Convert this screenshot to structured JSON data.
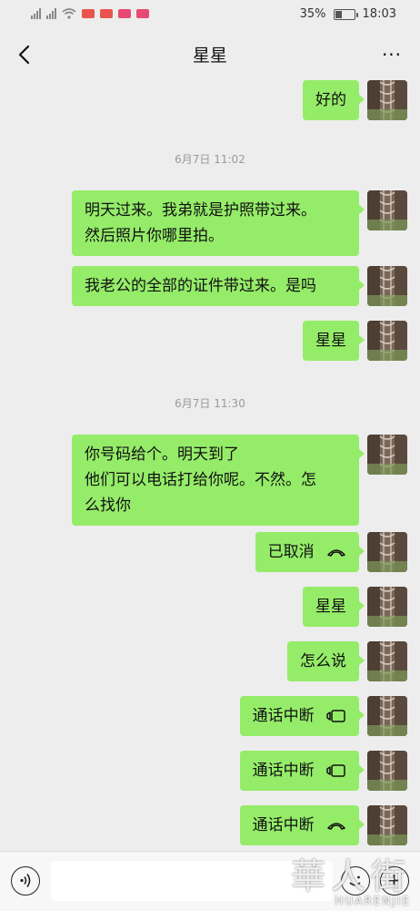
{
  "status_bar": {
    "battery_percent": "35%",
    "battery_level": 0.35,
    "time": "18:03"
  },
  "header": {
    "title": "星星",
    "back_icon": "chevron-left-icon",
    "more_icon": "more-dots-icon",
    "more_label": "···"
  },
  "messages": [
    {
      "type": "text",
      "text": "好的"
    },
    {
      "type": "timestamp",
      "text": "6月7日 11:02"
    },
    {
      "type": "text",
      "lines": [
        "明天过来。我弟就是护照带过来。",
        "然后照片你哪里拍。"
      ]
    },
    {
      "type": "text",
      "text": "我老公的全部的证件带过来。是吗"
    },
    {
      "type": "text",
      "text": "星星"
    },
    {
      "type": "timestamp",
      "text": "6月7日 11:30"
    },
    {
      "type": "text",
      "lines": [
        "你号码给个。明天到了",
        "他们可以电话打给你呢。不然。怎",
        "么找你"
      ]
    },
    {
      "type": "call",
      "text": "已取消",
      "icon": "phone-hangup-icon"
    },
    {
      "type": "text",
      "text": "星星"
    },
    {
      "type": "text",
      "text": "怎么说"
    },
    {
      "type": "call",
      "text": "通话中断",
      "icon": "video-call-icon"
    },
    {
      "type": "call",
      "text": "通话中断",
      "icon": "video-call-icon"
    },
    {
      "type": "call",
      "text": "通话中断",
      "icon": "phone-hangup-icon"
    }
  ],
  "input_bar": {
    "voice_icon": "voice-icon",
    "emoji_icon": "emoji-icon",
    "plus_icon": "plus-icon"
  },
  "watermark": {
    "cn": "華人街",
    "en": "HUARENJIE"
  },
  "colors": {
    "bubble": "#95ec69",
    "background": "#ededed"
  }
}
